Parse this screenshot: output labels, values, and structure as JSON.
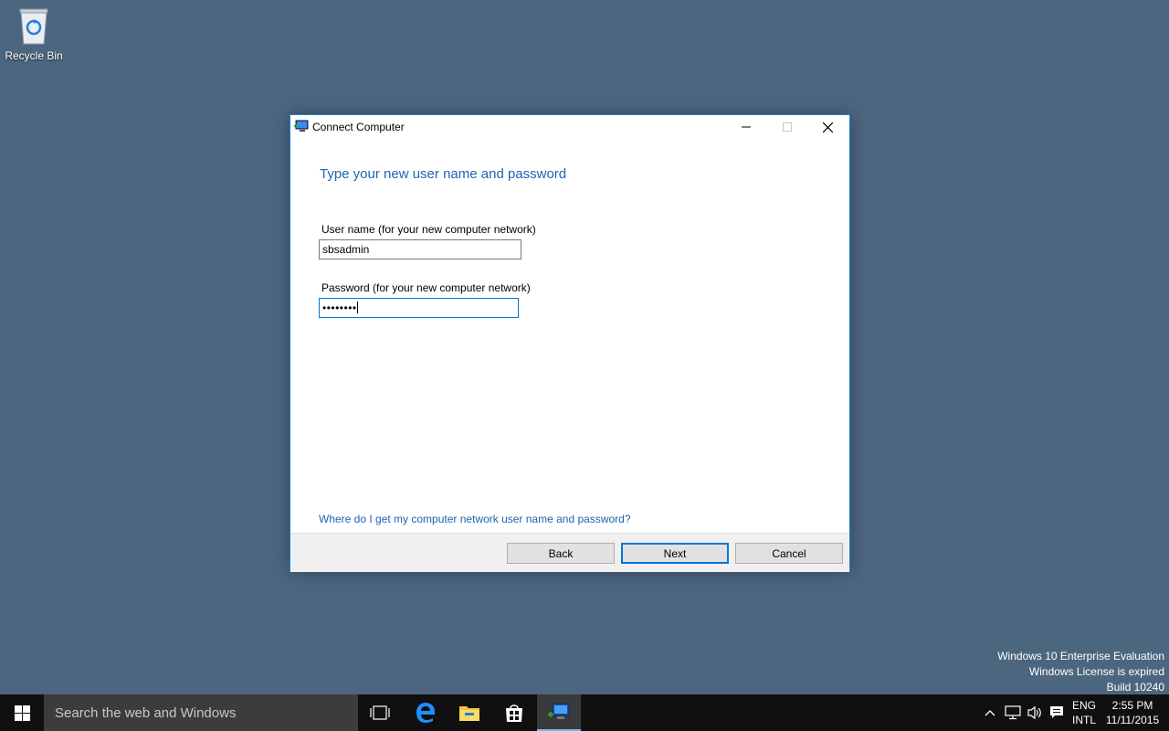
{
  "desktop": {
    "recycle_bin_label": "Recycle Bin",
    "watermark": {
      "line1": "Windows 10 Enterprise Evaluation",
      "line2": "Windows License is expired",
      "line3": "Build 10240"
    }
  },
  "window": {
    "title": "Connect Computer",
    "heading": "Type your new user name and password",
    "username_label": "User name (for your new computer network)",
    "username_value": "sbsadmin",
    "password_label": "Password (for your new computer network)",
    "password_value": "••••••••",
    "help_link": "Where do I get my computer network user name and password?",
    "buttons": {
      "back": "Back",
      "next": "Next",
      "cancel": "Cancel"
    },
    "accent_color": "#1e64b4"
  },
  "taskbar": {
    "search_placeholder": "Search the web and Windows",
    "language_top": "ENG",
    "language_bottom": "INTL",
    "time": "2:55 PM",
    "date": "11/11/2015",
    "icons": [
      "windows-start-icon",
      "task-view-icon",
      "edge-icon",
      "file-explorer-icon",
      "store-icon",
      "connect-computer-icon"
    ],
    "tray_icons": [
      "chevron-up-icon",
      "network-icon",
      "volume-icon",
      "action-center-icon"
    ]
  }
}
